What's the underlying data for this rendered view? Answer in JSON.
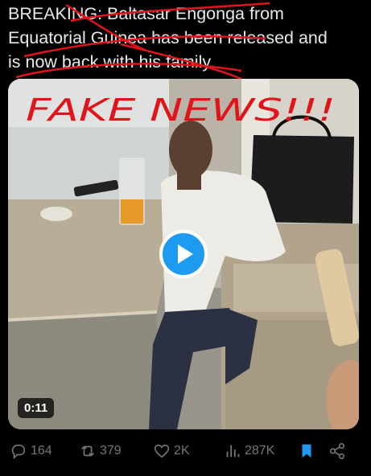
{
  "tweet": {
    "lines": [
      "BREAKING: Baltasar Engonga from",
      "Equatorial Guinea has been released and",
      "is now back with his family."
    ],
    "overlay_text": "FAKE NEWS!!!"
  },
  "video": {
    "duration": "0:11",
    "play_icon": "play-icon"
  },
  "actions": {
    "replies": "164",
    "reposts": "379",
    "likes": "2K",
    "views": "287K"
  },
  "colors": {
    "accent": "#1d9bf0",
    "overlay_red": "#e0151b",
    "muted": "#71767b"
  }
}
